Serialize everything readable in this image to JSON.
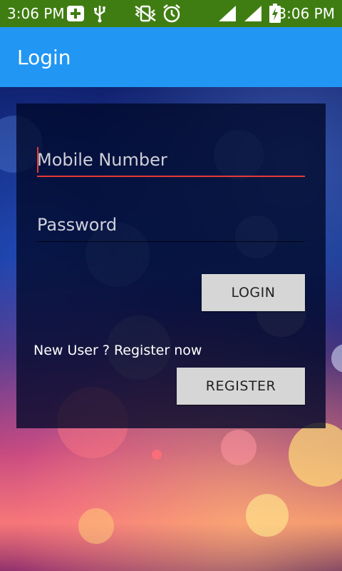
{
  "status_bar": {
    "time_left": "3:06 PM",
    "time_right": "3:06 PM",
    "bg_color": "#3f7d12",
    "icons": [
      "plus-notification-icon",
      "usb-icon",
      "vibrate-icon",
      "alarm-icon",
      "signal-icon",
      "signal-icon-2",
      "battery-charging-icon"
    ]
  },
  "app_bar": {
    "title": "Login",
    "bg_color": "#2196f3"
  },
  "form": {
    "mobile_placeholder": "Mobile Number",
    "password_placeholder": "Password",
    "login_label": "LOGIN",
    "register_prompt": "New User ? Register now",
    "register_label": "REGISTER",
    "accent_color": "#e53935"
  }
}
